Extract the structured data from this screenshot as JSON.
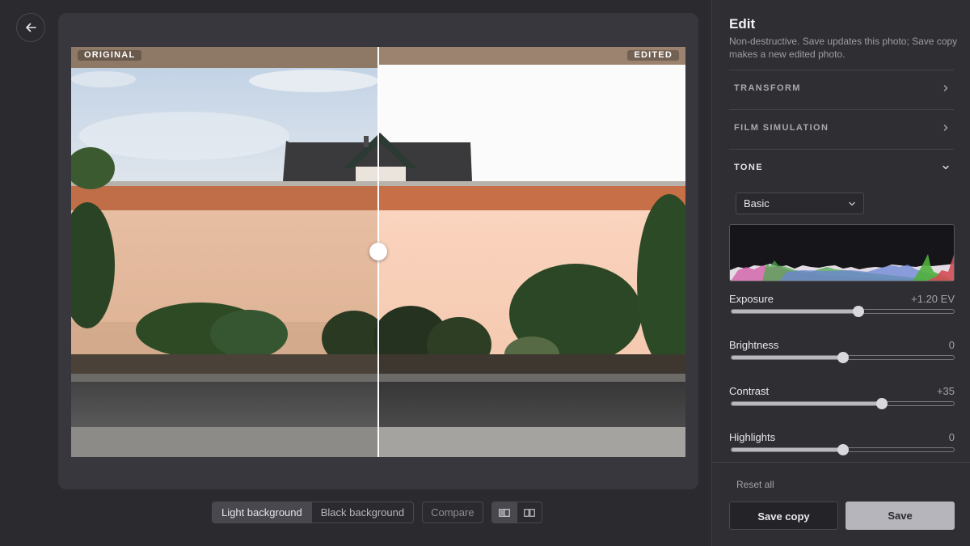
{
  "canvas": {
    "original_tag": "ORIGINAL",
    "edited_tag": "EDITED",
    "split_position": 0.5
  },
  "toolbar": {
    "light_bg": "Light background",
    "black_bg": "Black background",
    "compare": "Compare",
    "view_split_icon": "split-view-icon",
    "view_side_by_side_icon": "side-by-side-icon"
  },
  "panel": {
    "title": "Edit",
    "subtitle": "Non-destructive. Save updates this photo; Save copy makes a new edited photo.",
    "sections": [
      {
        "label": "TRANSFORM",
        "state": "collapsed"
      },
      {
        "label": "FILM SIMULATION",
        "state": "collapsed"
      },
      {
        "label": "TONE",
        "state": "expanded"
      }
    ],
    "tone_mode": "Basic",
    "sliders": [
      {
        "label": "Exposure",
        "value": "+1.20 EV",
        "position": 0.57
      },
      {
        "label": "Brightness",
        "value": "0",
        "position": 0.5
      },
      {
        "label": "Contrast",
        "value": "+35",
        "position": 0.675
      },
      {
        "label": "Highlights",
        "value": "0",
        "position": 0.5
      }
    ],
    "reset_label": "Reset all",
    "save_copy_label": "Save copy",
    "save_label": "Save"
  },
  "colors": {
    "panel_bg": "#2f2e33",
    "canvas_bg": "#38373d",
    "primary_button": "#b6b5bb"
  }
}
